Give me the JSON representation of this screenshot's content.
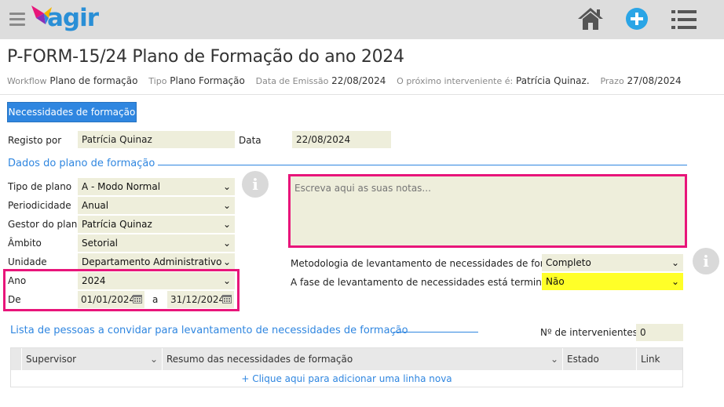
{
  "app": {
    "logo_text": "agir",
    "brand_color": "#2a8fd6",
    "accent_color": "#2f86e0",
    "highlight_color": "#e8157a",
    "icons": [
      "menu-icon",
      "home-icon",
      "add-icon",
      "list-icon"
    ]
  },
  "header": {
    "title": "P-FORM-15/24 Plano de Formação do ano 2024",
    "workflow_label": "Workflow",
    "workflow_value": "Plano de formação",
    "tipo_label": "Tipo",
    "tipo_value": "Plano Formação",
    "emissao_label": "Data de Emissão",
    "emissao_value": "22/08/2024",
    "interveniente_label": "O próximo interveniente é:",
    "interveniente_value": "Patrícia Quinaz.",
    "prazo_label": "Prazo",
    "prazo_value": "27/08/2024"
  },
  "tabs": {
    "necessidades": "Necessidades de formação"
  },
  "registo": {
    "registo_label": "Registo por",
    "registo_value": "Patrícia Quinaz",
    "data_label": "Data",
    "data_value": "22/08/2024"
  },
  "dados": {
    "section_title": "Dados do plano de formação",
    "tipo_plano_label": "Tipo de plano",
    "tipo_plano_value": "A - Modo Normal",
    "periodicidade_label": "Periodicidade",
    "periodicidade_value": "Anual",
    "gestor_label": "Gestor do plano",
    "gestor_value": "Patrícia Quinaz",
    "ambito_label": "Âmbito",
    "ambito_value": "Setorial",
    "unidade_label": "Unidade",
    "unidade_value": "Departamento Administrativo",
    "ano_label": "Ano",
    "ano_value": "2024",
    "de_label": "De",
    "de_value": "01/01/2024",
    "a_label": "a",
    "ate_value": "31/12/2024",
    "notes_placeholder": "Escreva aqui as suas notas...",
    "metodologia_label": "Metodologia de levantamento de necessidades de formação",
    "metodologia_value": "Completo",
    "fase_label": "A fase de levantamento de necessidades está terminada?",
    "fase_value": "Não"
  },
  "lista": {
    "section_title": "Lista de pessoas a convidar para levantamento de necessidades de formação",
    "intervenientes_label": "Nº de intervenientes",
    "intervenientes_value": "0",
    "columns": [
      "Supervisor",
      "Resumo das necessidades de formação",
      "Estado",
      "Link"
    ],
    "add_row": "+ Clique aqui para adicionar uma linha nova"
  }
}
